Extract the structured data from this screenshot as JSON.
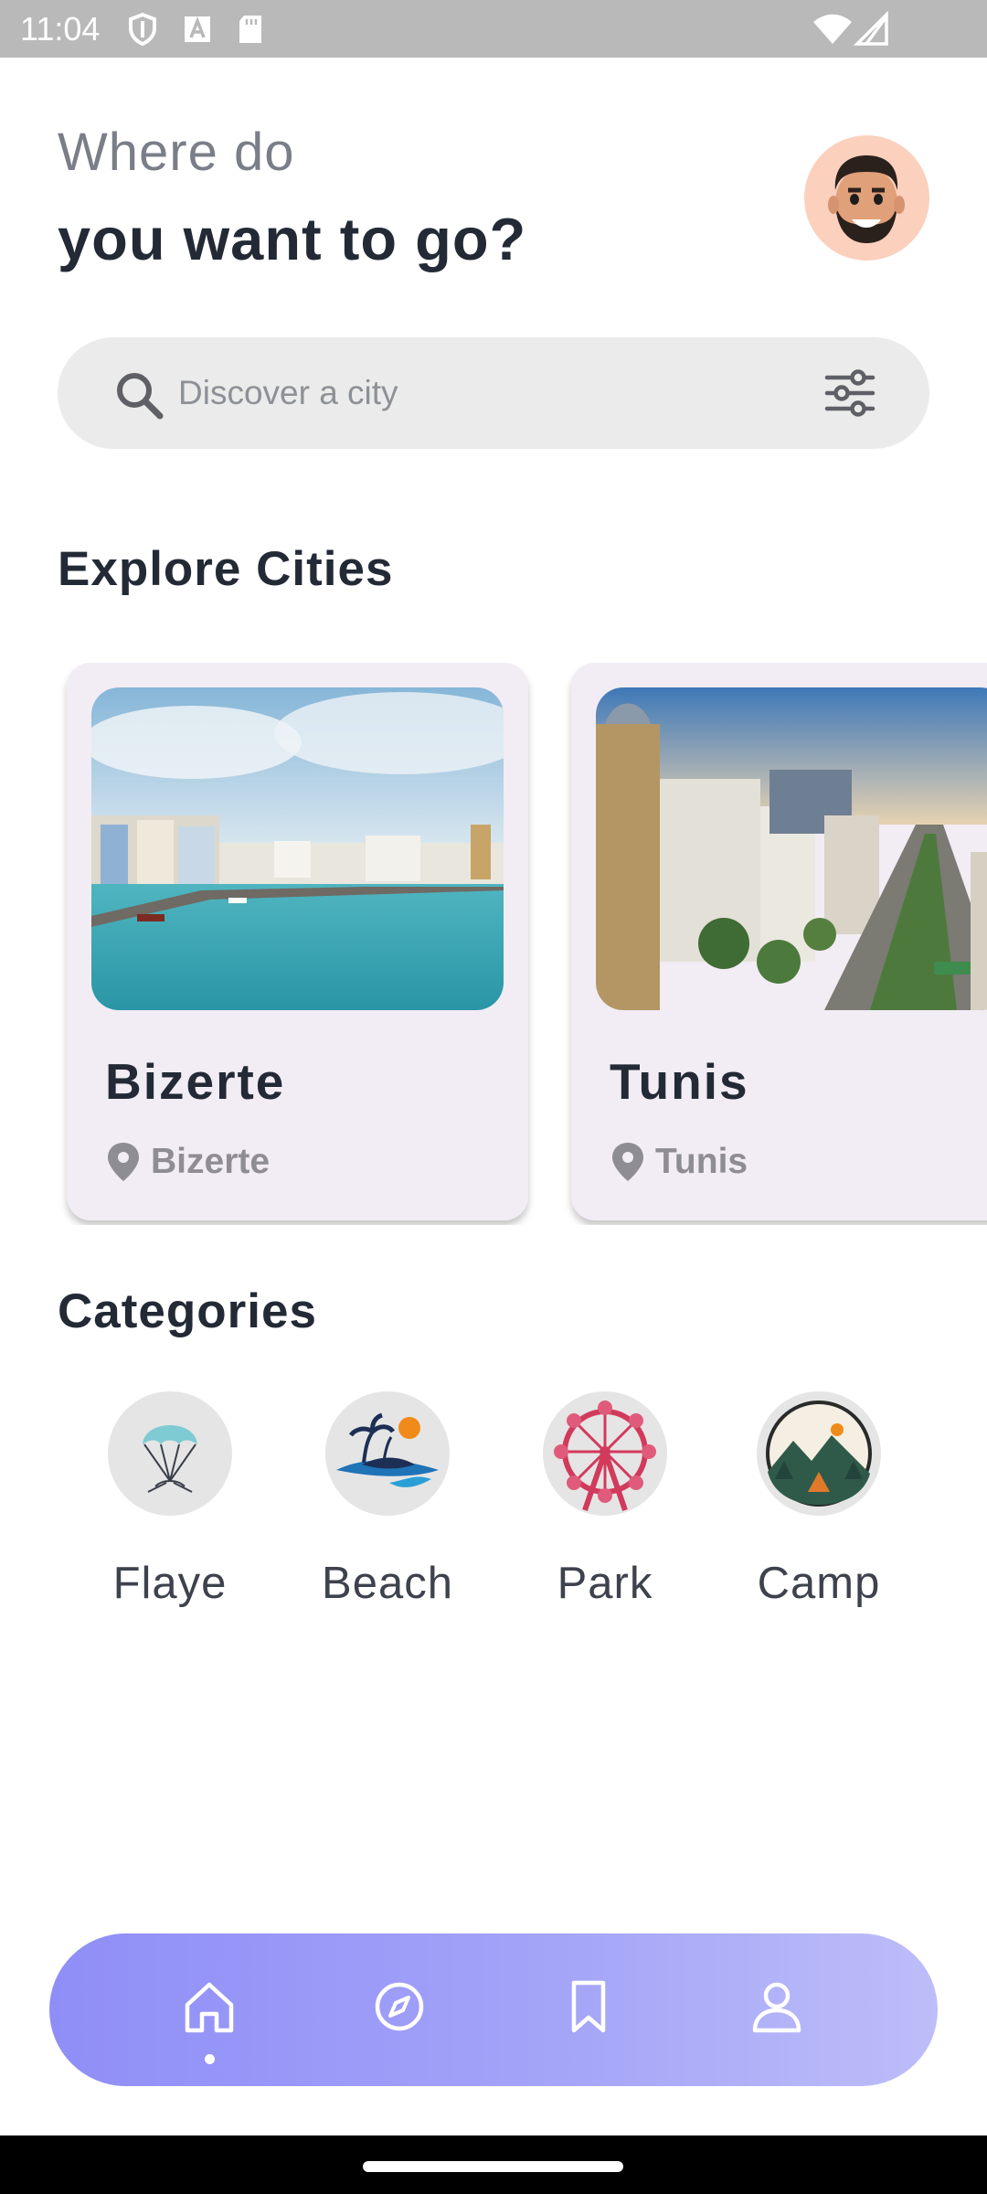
{
  "status_bar": {
    "time": "11:04",
    "icons": [
      "shield-icon",
      "a-icon",
      "sd-card-icon",
      "wifi-icon",
      "signal-icon"
    ]
  },
  "header": {
    "line1": "Where do",
    "line2": "you want to go?",
    "avatar_icon": "memoji-avatar"
  },
  "search": {
    "placeholder": "Discover a city",
    "icon": "search-icon",
    "filter_icon": "filter-sliders-icon"
  },
  "explore": {
    "title": "Explore Cities",
    "cities": [
      {
        "name": "Bizerte",
        "location": "Bizerte"
      },
      {
        "name": "Tunis",
        "location": "Tunis"
      }
    ]
  },
  "categories": {
    "title": "Categories",
    "items": [
      {
        "label": "Flaye",
        "icon": "parachute-icon"
      },
      {
        "label": "Beach",
        "icon": "beach-island-icon"
      },
      {
        "label": "Park",
        "icon": "ferris-wheel-icon"
      },
      {
        "label": "Camp",
        "icon": "camping-tent-icon"
      }
    ]
  },
  "bottom_nav": {
    "items": [
      "home-icon",
      "compass-icon",
      "bookmark-icon",
      "profile-icon"
    ],
    "active": "home-icon"
  },
  "colors": {
    "text_dark": "#232a36",
    "text_muted": "#7a7e88",
    "card_bg": "#f2ecf4",
    "search_bg": "#ebebeb",
    "nav_gradient_start": "#8f8ef7",
    "nav_gradient_end": "#bdbdf9",
    "avatar_bg": "#fbd0bd"
  }
}
